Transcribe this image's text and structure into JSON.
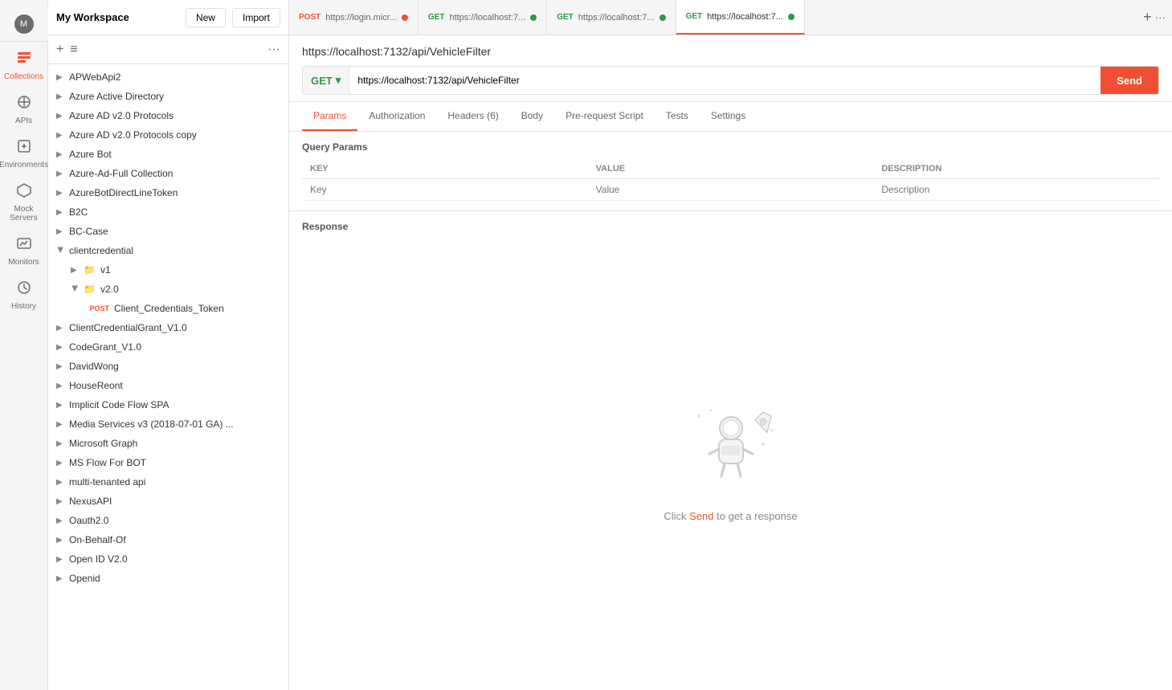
{
  "workspace": {
    "name": "My Workspace",
    "initials": "M"
  },
  "header_buttons": {
    "new_label": "New",
    "import_label": "Import"
  },
  "sidebar": {
    "nav_items": [
      {
        "id": "collections",
        "label": "Collections",
        "icon": "📁",
        "active": true
      },
      {
        "id": "apis",
        "label": "APIs",
        "icon": "⊞"
      },
      {
        "id": "environments",
        "label": "Environments",
        "icon": "🌐"
      },
      {
        "id": "mock-servers",
        "label": "Mock Servers",
        "icon": "⬡"
      },
      {
        "id": "monitors",
        "label": "Monitors",
        "icon": "📊"
      },
      {
        "id": "history",
        "label": "History",
        "icon": "🕒"
      }
    ],
    "toolbar": {
      "add_label": "+",
      "filter_label": "≡",
      "more_label": "···"
    },
    "collections": [
      {
        "name": "APWebApi2",
        "level": 0,
        "expanded": false
      },
      {
        "name": "Azure Active Directory",
        "level": 0,
        "expanded": false
      },
      {
        "name": "Azure AD v2.0 Protocols",
        "level": 0,
        "expanded": false
      },
      {
        "name": "Azure AD v2.0 Protocols copy",
        "level": 0,
        "expanded": false
      },
      {
        "name": "Azure Bot",
        "level": 0,
        "expanded": false
      },
      {
        "name": "Azure-Ad-Full Collection",
        "level": 0,
        "expanded": false
      },
      {
        "name": "AzureBotDirectLineToken",
        "level": 0,
        "expanded": false
      },
      {
        "name": "B2C",
        "level": 0,
        "expanded": false
      },
      {
        "name": "BC-Case",
        "level": 0,
        "expanded": false
      },
      {
        "name": "clientcredential",
        "level": 0,
        "expanded": true
      },
      {
        "name": "v1",
        "level": 1,
        "expanded": false,
        "is_folder": true
      },
      {
        "name": "v2.0",
        "level": 1,
        "expanded": false,
        "is_folder": true
      },
      {
        "name": "Client_Credentials_Token",
        "level": 2,
        "method": "POST"
      },
      {
        "name": "ClientCredentialGrant_V1.0",
        "level": 0,
        "expanded": false
      },
      {
        "name": "CodeGrant_V1.0",
        "level": 0,
        "expanded": false
      },
      {
        "name": "DavidWong",
        "level": 0,
        "expanded": false
      },
      {
        "name": "HouseReont",
        "level": 0,
        "expanded": false
      },
      {
        "name": "Implicit Code Flow SPA",
        "level": 0,
        "expanded": false
      },
      {
        "name": "Media Services v3 (2018-07-01 GA) ...",
        "level": 0,
        "expanded": false
      },
      {
        "name": "Microsoft Graph",
        "level": 0,
        "expanded": false
      },
      {
        "name": "MS Flow For BOT",
        "level": 0,
        "expanded": false
      },
      {
        "name": "multi-tenanted api",
        "level": 0,
        "expanded": false
      },
      {
        "name": "NexusAPI",
        "level": 0,
        "expanded": false
      },
      {
        "name": "Oauth2.0",
        "level": 0,
        "expanded": false
      },
      {
        "name": "On-Behalf-Of",
        "level": 0,
        "expanded": false
      },
      {
        "name": "Open ID V2.0",
        "level": 0,
        "expanded": false
      },
      {
        "name": "Openid",
        "level": 0,
        "expanded": false
      }
    ]
  },
  "tabs": [
    {
      "id": "tab1",
      "method": "POST",
      "url": "https://login.micr...",
      "has_dot": true,
      "active": false
    },
    {
      "id": "tab2",
      "method": "GET",
      "url": "https://localhost:7...",
      "has_dot": true,
      "active": false
    },
    {
      "id": "tab3",
      "method": "GET",
      "url": "https://localhost:7...",
      "has_dot": true,
      "active": false
    },
    {
      "id": "tab4",
      "method": "GET",
      "url": "https://localhost:7...",
      "has_dot": true,
      "active": true
    }
  ],
  "request": {
    "title": "https://localhost:7132/api/VehicleFilter",
    "method": "GET",
    "url": "https://localhost:7132/api/VehicleFilter",
    "send_label": "Send",
    "tabs": [
      {
        "id": "params",
        "label": "Params",
        "active": true
      },
      {
        "id": "authorization",
        "label": "Authorization",
        "active": false
      },
      {
        "id": "headers",
        "label": "Headers (6)",
        "active": false
      },
      {
        "id": "body",
        "label": "Body",
        "active": false
      },
      {
        "id": "pre-request-script",
        "label": "Pre-request Script",
        "active": false
      },
      {
        "id": "tests",
        "label": "Tests",
        "active": false
      },
      {
        "id": "settings",
        "label": "Settings",
        "active": false
      }
    ],
    "params": {
      "section_title": "Query Params",
      "columns": [
        "KEY",
        "VALUE",
        "DESCRIPTION"
      ],
      "placeholder_key": "Key",
      "placeholder_value": "Value",
      "placeholder_desc": "Description"
    }
  },
  "response": {
    "title": "Response",
    "empty_hint": "Click Send to get a response",
    "hint_link": "Send"
  }
}
